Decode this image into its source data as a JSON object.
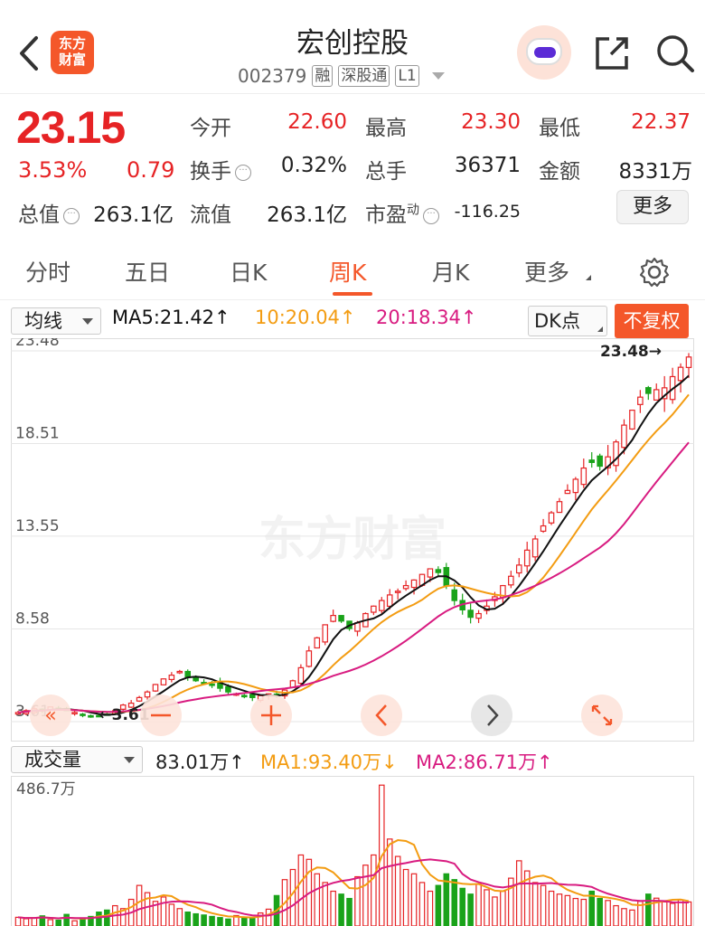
{
  "header": {
    "title": "宏创控股",
    "code": "002379",
    "tags": [
      "融",
      "深股通",
      "L1"
    ],
    "logo_lines": [
      "东方",
      "财富"
    ]
  },
  "quote": {
    "price": "23.15",
    "change_pct": "3.53%",
    "change": "0.79",
    "open_label": "今开",
    "open": "22.60",
    "high_label": "最高",
    "high": "23.30",
    "low_label": "最低",
    "low": "22.37",
    "turnover_label": "换手",
    "turnover": "0.32%",
    "volume_label": "总手",
    "volume": "36371",
    "amount_label": "金额",
    "amount": "8331万",
    "mktcap_label": "总值",
    "mktcap": "263.1亿",
    "float_label": "流值",
    "float": "263.1亿",
    "pe_label": "市盈",
    "pe_sup": "动",
    "pe": "-116.25",
    "more_label": "更多"
  },
  "tabs": [
    {
      "label": "分时",
      "active": false
    },
    {
      "label": "五日",
      "active": false
    },
    {
      "label": "日K",
      "active": false
    },
    {
      "label": "周K",
      "active": true
    },
    {
      "label": "月K",
      "active": false
    },
    {
      "label": "更多",
      "active": false
    }
  ],
  "ma_bar": {
    "selector": "均线",
    "ma5": "MA5:21.42↑",
    "ma10": "10:20.04↑",
    "ma20": "20:18.34↑",
    "dk": "DK点",
    "fuquan": "不复权"
  },
  "vol_bar": {
    "selector": "成交量",
    "vol": "83.01万↑",
    "ma1": "MA1:93.40万↓",
    "ma2": "MA2:86.71万↑"
  },
  "colors": {
    "up": "#e62325",
    "down": "#1aa31a",
    "accent": "#f4572a",
    "ma5": "#111111",
    "ma10": "#f39c12",
    "ma20": "#d81b80"
  },
  "chart_data": {
    "type": "candlestick",
    "watermark": "东方财富",
    "y_ticks": [
      "23.48",
      "18.51",
      "13.55",
      "8.58",
      "3.61"
    ],
    "ylim": [
      3.61,
      23.48
    ],
    "max_label": "23.48→",
    "min_label": "←3.61",
    "volume_top_label": "486.7万",
    "volume_ylim": [
      0,
      486.7
    ],
    "close": [
      4.1,
      4.2,
      4.3,
      4.2,
      4.4,
      4.3,
      4.2,
      4.1,
      4.0,
      3.9,
      3.9,
      4.0,
      4.2,
      4.5,
      4.6,
      4.9,
      5.2,
      5.6,
      5.9,
      6.1,
      6.3,
      6.0,
      5.8,
      5.7,
      5.6,
      5.4,
      5.2,
      5.1,
      5.0,
      4.9,
      5.0,
      5.1,
      5.0,
      5.3,
      5.8,
      6.5,
      7.4,
      8.1,
      8.8,
      9.3,
      9.0,
      8.6,
      8.9,
      9.4,
      9.8,
      10.1,
      10.4,
      10.6,
      10.9,
      11.2,
      11.5,
      11.8,
      11.6,
      10.9,
      10.1,
      9.6,
      9.2,
      9.4,
      9.8,
      10.3,
      10.9,
      11.4,
      12.0,
      12.8,
      13.4,
      14.1,
      14.8,
      15.4,
      16.0,
      16.6,
      17.2,
      17.5,
      17.3,
      17.8,
      18.6,
      19.5,
      20.3,
      21.0,
      21.2,
      21.4,
      21.5,
      22.1,
      22.6,
      23.15
    ],
    "volume": [
      30,
      25,
      28,
      35,
      22,
      20,
      40,
      18,
      26,
      33,
      48,
      55,
      70,
      60,
      92,
      140,
      115,
      85,
      100,
      75,
      60,
      48,
      42,
      38,
      33,
      29,
      24,
      36,
      30,
      28,
      45,
      58,
      105,
      160,
      195,
      245,
      230,
      180,
      150,
      120,
      110,
      95,
      170,
      210,
      245,
      486,
      300,
      240,
      195,
      180,
      150,
      120,
      140,
      180,
      160,
      130,
      110,
      145,
      125,
      100,
      120,
      165,
      225,
      190,
      150,
      140,
      120,
      110,
      105,
      95,
      92,
      120,
      95,
      88,
      70,
      60,
      55,
      85,
      110,
      96,
      83,
      78,
      90,
      83
    ]
  }
}
